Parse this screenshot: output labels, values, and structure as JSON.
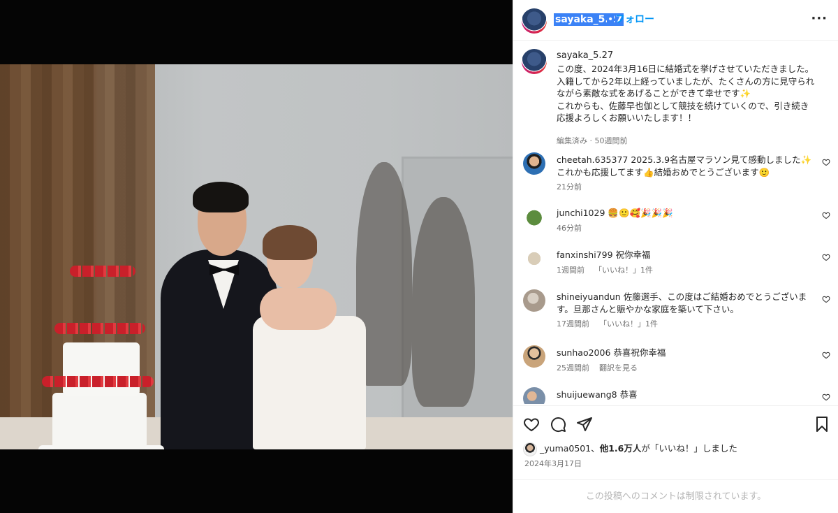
{
  "header": {
    "username": "sayaka_5.27",
    "dot": "•",
    "follow_label": "フォロー",
    "more_label": "···"
  },
  "caption": {
    "username": "sayaka_5.27",
    "text": "この度、2024年3月16日に結婚式を挙げさせていただきました。\n入籍してから2年以上経っていましたが、たくさんの方に見守られながら素敵な式をあげることができて幸せです✨\nこれからも、佐藤早也伽として競技を続けていくので、引き続き応援よろしくお願いいたします！！",
    "meta": "編集済み · 50週間前"
  },
  "comments": [
    {
      "username": "cheetah.635377",
      "text": "2025.3.9名古屋マラソン見て感動しました✨\nこれかも応援してます👍結婚おめでとうございます🙂",
      "time": "21分前",
      "likes": "",
      "action": "",
      "avatar_color": "#2d6fb3"
    },
    {
      "username": "junchi1029",
      "text": "🍔🙂🥰🎉🎉🎉",
      "time": "46分前",
      "likes": "",
      "action": "",
      "avatar_color": "#4f7a3a"
    },
    {
      "username": "fanxinshi799",
      "text": "祝你幸福",
      "time": "1週間前",
      "likes": "「いいね！」1件",
      "action": "",
      "avatar_color": "#d9cdb8"
    },
    {
      "username": "shineiyuandun",
      "text": "佐藤選手、この度はご結婚おめでとうございます。旦那さんと賑やかな家庭を築いて下さい。",
      "time": "17週間前",
      "likes": "「いいね！」1件",
      "action": "",
      "avatar_color": "#a89a8c"
    },
    {
      "username": "sunhao2006",
      "text": "恭喜祝你幸福",
      "time": "25週間前",
      "likes": "",
      "action": "翻訳を見る",
      "avatar_color": "#c9a47a"
    },
    {
      "username": "shuijuewang8",
      "text": "恭喜",
      "time": "",
      "likes": "",
      "action": "",
      "avatar_color": "#7a8fa8"
    }
  ],
  "actions": {
    "like_icon": "heart-icon",
    "comment_icon": "comment-icon",
    "share_icon": "share-icon",
    "save_icon": "bookmark-icon"
  },
  "likes": {
    "user": "_yuma0501",
    "separator": "、",
    "count_text": "他1.6万人",
    "suffix": "が「いいね！」しました"
  },
  "post_date": "2024年3月17日",
  "footer": {
    "comments_disabled": "この投稿へのコメントは制限されています。"
  }
}
